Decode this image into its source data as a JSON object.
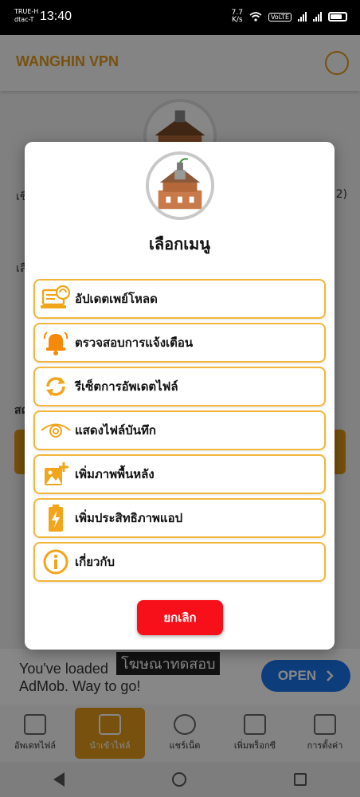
{
  "status_bar": {
    "carrier_line1": "TRUE-H",
    "carrier_line2": "dtac-T",
    "time": "13:40",
    "speed_value": "7.7",
    "speed_unit": "K/s",
    "volte": "VoLTE"
  },
  "app": {
    "title": "WANGHIN VPN",
    "bg_text_left1": "เชิ",
    "bg_text_right1": "2)",
    "bg_text_left2": "เลื",
    "bg_text_left3": "สถ"
  },
  "dialog": {
    "title": "เลือกเมนู",
    "items": [
      {
        "label": "อัปเดตเพย์โหลด",
        "icon": "update-laptop-icon"
      },
      {
        "label": "ตรวจสอบการแจ้งเตือน",
        "icon": "bell-icon"
      },
      {
        "label": "รีเซ็ตการอัพเดตไฟล์",
        "icon": "refresh-icon"
      },
      {
        "label": "แสดงไฟล์บันทึก",
        "icon": "eye-icon"
      },
      {
        "label": "เพิ่มภาพพื้นหลัง",
        "icon": "add-image-icon"
      },
      {
        "label": "เพิ่มประสิทธิภาพแอป",
        "icon": "battery-icon"
      },
      {
        "label": "เกี่ยวกับ",
        "icon": "info-icon"
      }
    ],
    "cancel_label": "ยกเลิก"
  },
  "ad": {
    "line1": "You've loaded",
    "line2": "AdMob. Way to go!",
    "badge": "โฆษณาทดสอบ",
    "open_label": "OPEN"
  },
  "bottom_nav": [
    {
      "label": "อัพเดทไฟล์",
      "active": false
    },
    {
      "label": "นำเข้าไฟล์",
      "active": true
    },
    {
      "label": "แชร์เน็ต",
      "active": false
    },
    {
      "label": "เพิ่มพร็อกซี",
      "active": false
    },
    {
      "label": "การตั้งค่า",
      "active": false
    }
  ],
  "colors": {
    "accent": "#e0991a",
    "menu_border": "#f1b73c",
    "cancel": "#f7101a",
    "ad_button": "#1a73e8"
  }
}
